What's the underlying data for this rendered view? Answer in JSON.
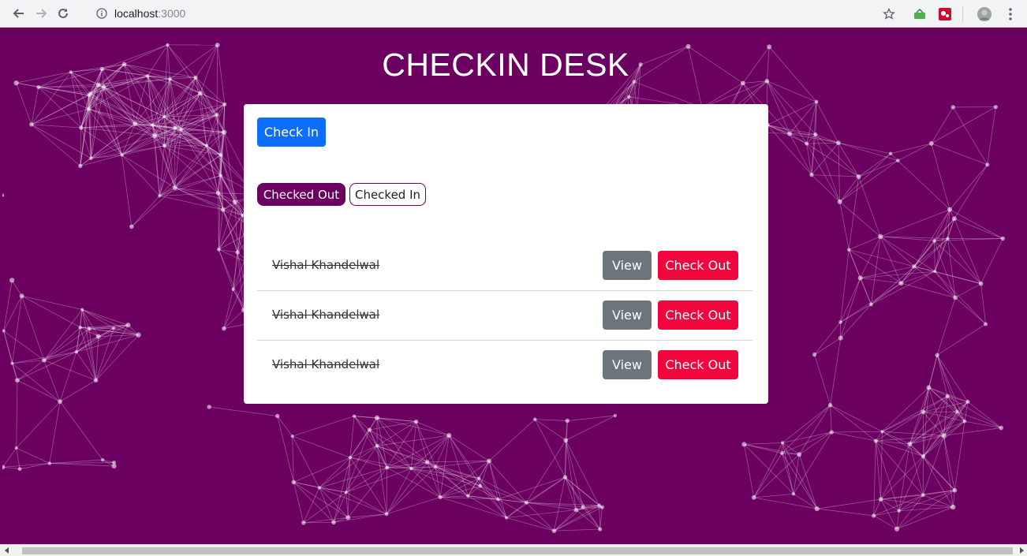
{
  "browser": {
    "url_host": "localhost",
    "url_port": ":3000"
  },
  "page": {
    "title": "CHECKIN DESK",
    "check_in_button": "Check In",
    "tabs": [
      {
        "label": "Checked Out",
        "active": true
      },
      {
        "label": "Checked In",
        "active": false
      }
    ],
    "rows": [
      {
        "name": "Vishal Khandelwal",
        "view_label": "View",
        "checkout_label": "Check Out"
      },
      {
        "name": "Vishal Khandelwal",
        "view_label": "View",
        "checkout_label": "Check Out"
      },
      {
        "name": "Vishal Khandelwal",
        "view_label": "View",
        "checkout_label": "Check Out"
      }
    ]
  },
  "colors": {
    "background": "#6b0061",
    "primary": "#0d6efd",
    "secondary": "#6c757d",
    "danger": "#f0053d"
  },
  "icons": [
    "back-icon",
    "forward-icon",
    "reload-icon",
    "info-icon",
    "star-icon",
    "extension-icon",
    "extension-icon",
    "avatar",
    "menu-icon"
  ]
}
